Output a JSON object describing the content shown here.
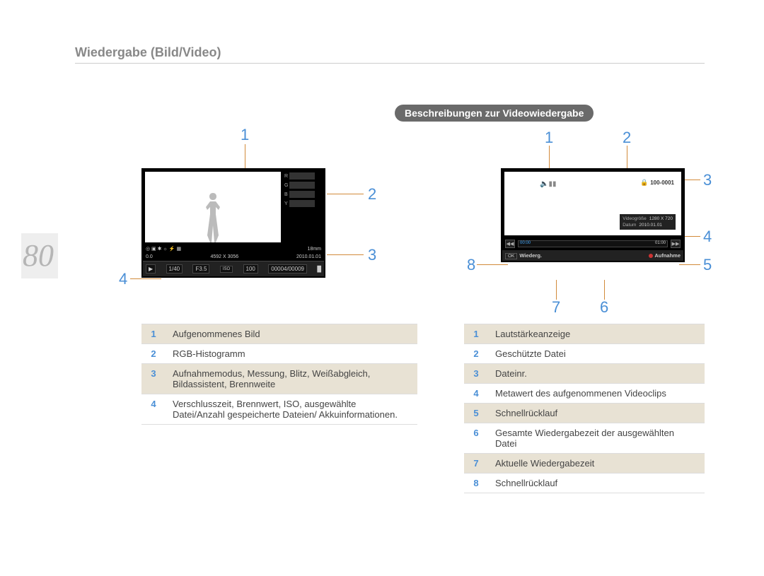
{
  "page_number": "80",
  "section_title": "Wiedergabe (Bild/Video)",
  "subtitle": "Beschreibungen zur Videowiedergabe",
  "accent_callout": "#4a8fd6",
  "leader_color": "#d28a3a",
  "image_playback": {
    "histogram_labels": [
      "R",
      "G",
      "B",
      "Y"
    ],
    "info1": {
      "focal": "18mm",
      "exposure": "0.0",
      "resolution": "4592 X 3056",
      "date": "2010.01.01"
    },
    "info2": {
      "play": "▶",
      "index": "1/40",
      "fnum": "F3.5",
      "iso_label": "ISO",
      "iso": "100",
      "files": "00004/00009",
      "battery": "█"
    },
    "callouts": [
      "1",
      "2",
      "3",
      "4"
    ],
    "legend": [
      {
        "n": "1",
        "text": "Aufgenommenes Bild"
      },
      {
        "n": "2",
        "text": "RGB-Histogramm"
      },
      {
        "n": "3",
        "text": "Aufnahmemodus, Messung, Blitz, Weißabgleich, Bildassistent, Brennweite"
      },
      {
        "n": "4",
        "text": "Verschlusszeit, Brennwert, ISO, ausgewählte Datei/Anzahl gespeicherte Dateien/ Akkuinformationen."
      }
    ]
  },
  "video_playback": {
    "file_no": "100-0001",
    "meta": {
      "size_label": "Videogröße",
      "size_value": "1280 X 720",
      "date_label": "Datum",
      "date_value": "2010.01.01"
    },
    "progress": {
      "current": "00:00",
      "total": "01:00"
    },
    "bottom": {
      "ok": "OK",
      "play": "Wiederg.",
      "rec": "Aufnahme"
    },
    "callouts": [
      "1",
      "2",
      "3",
      "4",
      "5",
      "6",
      "7",
      "8"
    ],
    "legend": [
      {
        "n": "1",
        "text": "Lautstärkeanzeige"
      },
      {
        "n": "2",
        "text": "Geschützte Datei"
      },
      {
        "n": "3",
        "text": "Dateinr."
      },
      {
        "n": "4",
        "text": "Metawert des aufgenommenen Videoclips"
      },
      {
        "n": "5",
        "text": "Schnellrücklauf"
      },
      {
        "n": "6",
        "text": "Gesamte Wiedergabezeit der ausgewählten Datei"
      },
      {
        "n": "7",
        "text": "Aktuelle Wiedergabezeit"
      },
      {
        "n": "8",
        "text": "Schnellrücklauf"
      }
    ]
  }
}
